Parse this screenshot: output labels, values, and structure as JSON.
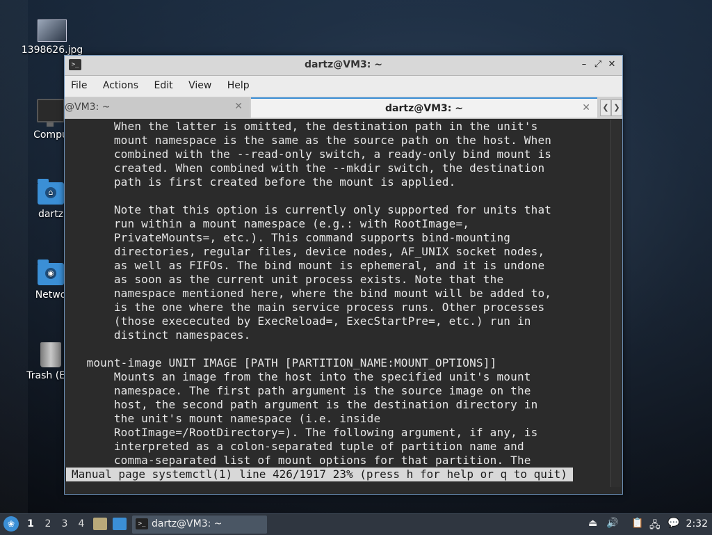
{
  "desktop": {
    "icons": [
      {
        "label": "1398626.jpg"
      },
      {
        "label": "Compu"
      },
      {
        "label": "dartz"
      },
      {
        "label": "Netwo"
      },
      {
        "label": "Trash (Em"
      }
    ]
  },
  "window": {
    "title": "dartz@VM3: ~",
    "menu": [
      "File",
      "Actions",
      "Edit",
      "View",
      "Help"
    ],
    "tabs": [
      {
        "label": "@VM3: ~",
        "active": false
      },
      {
        "label": "dartz@VM3: ~",
        "active": true
      }
    ],
    "terminal_lines": [
      "       When the latter is omitted, the destination path in the unit's",
      "       mount namespace is the same as the source path on the host. When",
      "       combined with the --read-only switch, a ready-only bind mount is",
      "       created. When combined with the --mkdir switch, the destination",
      "       path is first created before the mount is applied.",
      "",
      "       Note that this option is currently only supported for units that",
      "       run within a mount namespace (e.g.: with RootImage=,",
      "       PrivateMounts=, etc.). This command supports bind-mounting",
      "       directories, regular files, device nodes, AF_UNIX socket nodes,",
      "       as well as FIFOs. The bind mount is ephemeral, and it is undone",
      "       as soon as the current unit process exists. Note that the",
      "       namespace mentioned here, where the bind mount will be added to,",
      "       is the one where the main service process runs. Other processes",
      "       (those exececuted by ExecReload=, ExecStartPre=, etc.) run in",
      "       distinct namespaces.",
      "",
      "   mount-image UNIT IMAGE [PATH [PARTITION_NAME:MOUNT_OPTIONS]]",
      "       Mounts an image from the host into the specified unit's mount",
      "       namespace. The first path argument is the source image on the",
      "       host, the second path argument is the destination directory in",
      "       the unit's mount namespace (i.e. inside",
      "       RootImage=/RootDirectory=). The following argument, if any, is",
      "       interpreted as a colon-separated tuple of partition name and",
      "       comma-separated list of mount options for that partition. The"
    ],
    "status_line": "Manual page systemctl(1) line 426/1917 23% (press h for help or q to quit)"
  },
  "taskbar": {
    "workspaces": [
      "1",
      "2",
      "3",
      "4"
    ],
    "task_label": "dartz@VM3: ~",
    "clock": "2:32"
  }
}
